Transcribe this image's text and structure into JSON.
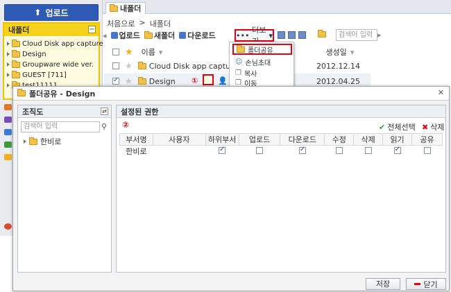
{
  "left": {
    "upload_label": "업로드",
    "tree_header": "내폴더",
    "tree_items": [
      "Cloud Disk app capture",
      "Design",
      "Groupware wide ver.",
      "GUEST [711]",
      "test11111"
    ]
  },
  "tab": {
    "label": "내폴더"
  },
  "breadcrumb": {
    "home": "처음으로",
    "separator": ">",
    "current": "내폴더"
  },
  "toolbar": {
    "upload": "업로드",
    "new_folder": "새폴더",
    "download": "다운로드",
    "more": "더보기",
    "search_placeholder": "검색어 입력"
  },
  "list": {
    "col_name": "이름",
    "col_created": "생성일",
    "rows": [
      {
        "name": "Cloud Disk app capture",
        "date": "2012.12.14"
      },
      {
        "name": "Design",
        "date": "2012.04.25"
      }
    ]
  },
  "dropdown": {
    "items": [
      "폴더공유",
      "손님초대",
      "복사",
      "이동"
    ]
  },
  "markers": {
    "one": "①",
    "two": "②"
  },
  "dialog": {
    "title": "폴더공유 - Design",
    "org_title": "조직도",
    "org_search_placeholder": "검색어 입력",
    "org_node": "한비로",
    "perm_title": "설정된 권한",
    "select_all": "전체선택",
    "delete": "삭제",
    "columns": [
      "부서명",
      "사용자",
      "하위부서",
      "업로드",
      "다운로드",
      "수정",
      "삭제",
      "읽기",
      "공유"
    ],
    "row": {
      "dept": "한비로",
      "user": "",
      "subdept": true,
      "upload": false,
      "download": true,
      "modify": false,
      "remove": false,
      "read": true,
      "share": false
    },
    "save": "저장",
    "close": "닫기"
  },
  "colors": {
    "accent_blue": "#2f5bb7",
    "highlight_red": "#e60012",
    "folder_yellow": "#f2c24a"
  }
}
